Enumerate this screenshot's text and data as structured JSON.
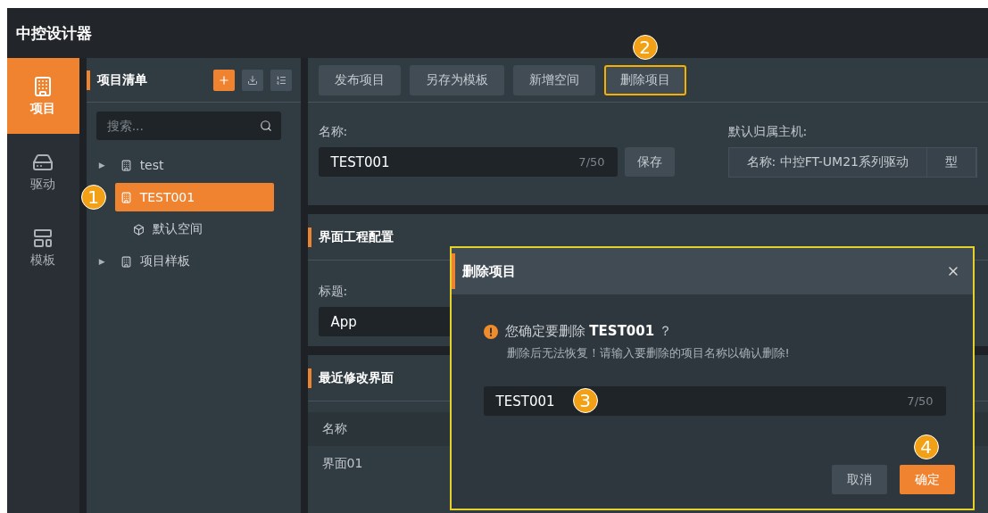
{
  "app_title": "中控设计器",
  "nav": [
    {
      "label": "项目",
      "selected": true
    },
    {
      "label": "驱动",
      "selected": false
    },
    {
      "label": "模板",
      "selected": false
    }
  ],
  "project_panel": {
    "title": "项目清单",
    "search_placeholder": "搜索...",
    "tree": [
      {
        "label": "test",
        "caret": "▶",
        "selected": false
      },
      {
        "label": "TEST001",
        "selected": true,
        "callout": "1",
        "children": [
          {
            "label": "默认空间",
            "selected": false
          }
        ]
      },
      {
        "label": "项目样板",
        "caret": "▶",
        "selected": false
      }
    ]
  },
  "toolbar": [
    {
      "label": "发布项目",
      "highlighted": false
    },
    {
      "label": "另存为模板",
      "highlighted": false
    },
    {
      "label": "新增空间",
      "highlighted": false
    },
    {
      "label": "删除项目",
      "highlighted": true,
      "callout": "2"
    }
  ],
  "basic": {
    "name_label": "名称:",
    "name_value": "TEST001",
    "name_count": "7/50",
    "save": "保存",
    "host_label": "默认归属主机:",
    "host_cells": [
      "名称: 中控FT-UM21系列驱动",
      "型"
    ]
  },
  "ui_config": {
    "title": "界面工程配置",
    "title_label": "标题:",
    "title_value": "App"
  },
  "recent": {
    "title": "最近修改界面",
    "column": "名称",
    "rows": [
      "界面01"
    ]
  },
  "dialog": {
    "title": "删除项目",
    "highlighted": true,
    "question": "您确定要删除 **TEST001** ？",
    "hint": "删除后无法恢复！请输入要删除的项目名称以确认删除!",
    "value": "TEST001",
    "count": "7/50",
    "callout": "3",
    "cancel": "取消",
    "confirm": "确定",
    "confirm_callout": "4"
  }
}
